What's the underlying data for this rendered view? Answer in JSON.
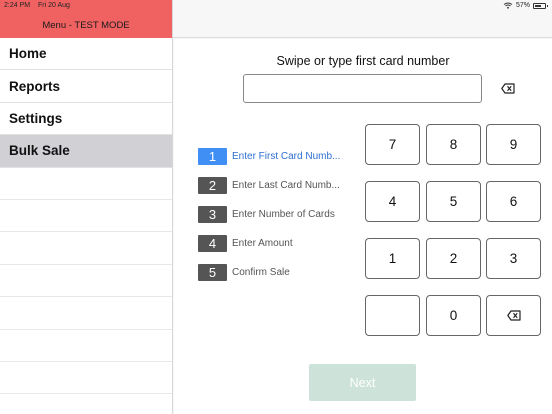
{
  "status_bar": {
    "time": "2:24 PM",
    "date": "Fri 20 Aug",
    "battery_percent": "57%",
    "battery_level": 0.57
  },
  "sidebar": {
    "header": "Menu - TEST MODE",
    "items": [
      {
        "label": "Home",
        "active": false
      },
      {
        "label": "Reports",
        "active": false
      },
      {
        "label": "Settings",
        "active": false
      },
      {
        "label": "Bulk Sale",
        "active": true
      }
    ]
  },
  "main": {
    "prompt": "Swipe or type first card number",
    "input_value": "",
    "steps": [
      {
        "number": "1",
        "label": "Enter First Card Numb...",
        "active": true
      },
      {
        "number": "2",
        "label": "Enter Last Card Numb...",
        "active": false
      },
      {
        "number": "3",
        "label": "Enter Number of Cards",
        "active": false
      },
      {
        "number": "4",
        "label": "Enter Amount",
        "active": false
      },
      {
        "number": "5",
        "label": "Confirm Sale",
        "active": false
      }
    ],
    "keypad": {
      "k7": "7",
      "k8": "8",
      "k9": "9",
      "k4": "4",
      "k5": "5",
      "k6": "6",
      "k1": "1",
      "k2": "2",
      "k3": "3",
      "k0": "0"
    },
    "next_label": "Next"
  },
  "icons": {
    "clear_input": "backspace-icon",
    "keypad_backspace": "backspace-icon",
    "wifi": "wifi-icon",
    "battery": "battery-icon"
  },
  "colors": {
    "header_red": "#f06262",
    "active_step": "#3f8ff5",
    "next_disabled": "#cde2d9"
  }
}
